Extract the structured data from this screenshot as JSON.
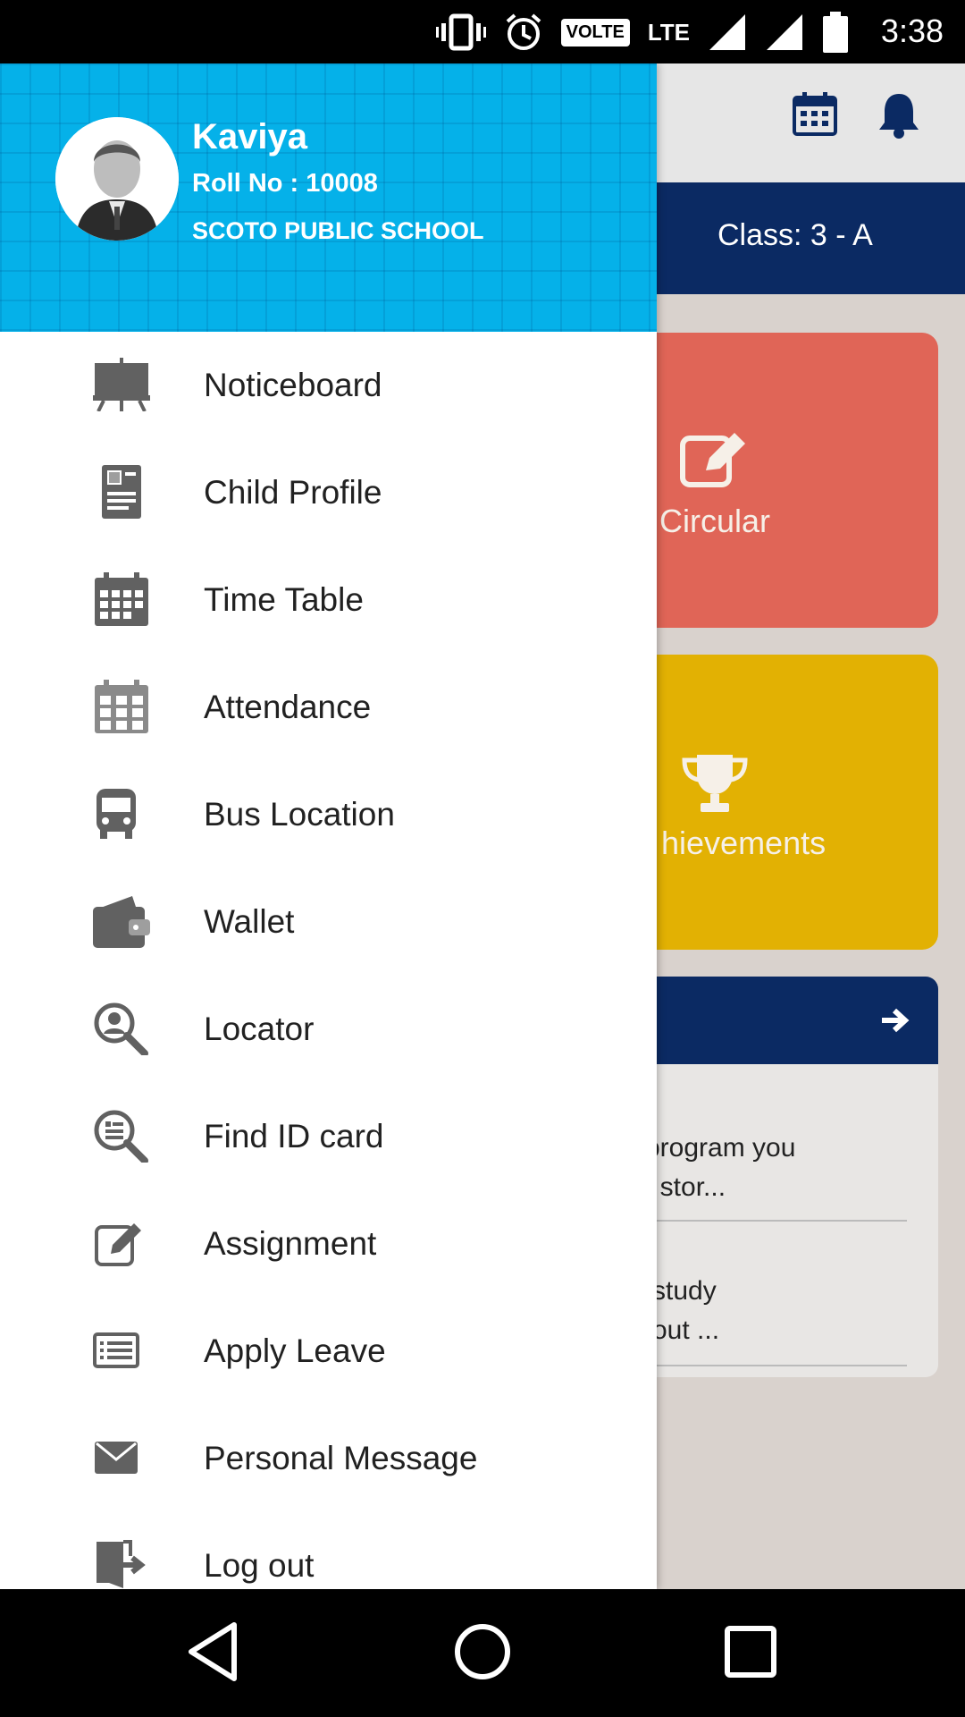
{
  "status_bar": {
    "time": "3:38",
    "volte": "VOLTE",
    "network": "LTE",
    "icons": [
      "vibrate-icon",
      "alarm-icon",
      "volte-icon",
      "lte-icon",
      "signal-icon",
      "signal-icon",
      "battery-icon"
    ]
  },
  "profile": {
    "name": "Kaviya",
    "roll": "Roll No : 10008",
    "school": "SCOTO PUBLIC SCHOOL"
  },
  "menu": {
    "items": [
      {
        "label": "Noticeboard",
        "icon": "easel-icon"
      },
      {
        "label": "Child Profile",
        "icon": "id-document-icon"
      },
      {
        "label": "Time Table",
        "icon": "calendar-icon"
      },
      {
        "label": "Attendance",
        "icon": "calendar-grid-icon"
      },
      {
        "label": "Bus Location",
        "icon": "bus-icon"
      },
      {
        "label": "Wallet",
        "icon": "wallet-icon"
      },
      {
        "label": "Locator",
        "icon": "person-search-icon"
      },
      {
        "label": "Find ID card",
        "icon": "id-search-icon"
      },
      {
        "label": "Assignment",
        "icon": "edit-icon"
      },
      {
        "label": "Apply Leave",
        "icon": "list-icon"
      },
      {
        "label": "Personal Message",
        "icon": "envelope-icon"
      },
      {
        "label": "Log out",
        "icon": "logout-icon"
      }
    ]
  },
  "background_app": {
    "class_label": "Class: 3 - A",
    "circular_label": "Circular",
    "achievements_label": "hievements",
    "news": [
      {
        "line1": "program you",
        "line2": "f stor..."
      },
      {
        "line1": "study",
        "line2": "out ..."
      }
    ]
  },
  "colors": {
    "drawer_header": "#05b1e9",
    "class_bar": "#0b2a63",
    "circular_card": "#e06557",
    "achievements_card": "#e2b103"
  }
}
